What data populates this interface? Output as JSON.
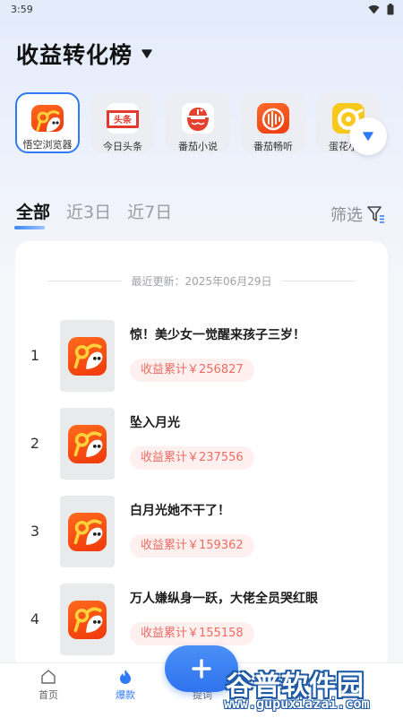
{
  "status_bar": {
    "time": "3:59"
  },
  "header": {
    "title": "收益转化榜"
  },
  "apps": [
    {
      "label": "悟空浏览器",
      "selected": true,
      "icon": "wukong-browser-icon"
    },
    {
      "label": "今日头条",
      "selected": false,
      "icon": "toutiao-icon"
    },
    {
      "label": "番茄小说",
      "selected": false,
      "icon": "fanqie-novel-icon"
    },
    {
      "label": "番茄畅听",
      "selected": false,
      "icon": "fanqie-listen-icon"
    },
    {
      "label": "蛋花小说",
      "selected": false,
      "icon": "danhua-novel-icon"
    }
  ],
  "tabs": [
    {
      "label": "全部",
      "active": true
    },
    {
      "label": "近3日",
      "active": false
    },
    {
      "label": "近7日",
      "active": false
    }
  ],
  "filter": {
    "label": "筛选"
  },
  "list": {
    "update_text": "最近更新：2025年06月29日",
    "items": [
      {
        "rank": "1",
        "title": "惊！美少女一觉醒来孩子三岁！",
        "earnings": "收益累计￥256827"
      },
      {
        "rank": "2",
        "title": "坠入月光",
        "earnings": "收益累计￥237556"
      },
      {
        "rank": "3",
        "title": "白月光她不干了！",
        "earnings": "收益累计￥159362"
      },
      {
        "rank": "4",
        "title": "万人嫌纵身一跃，大佬全员哭红眼",
        "earnings": "收益累计￥155158"
      }
    ]
  },
  "bottom_nav": [
    {
      "label": "首页",
      "icon": "home-icon",
      "active": false
    },
    {
      "label": "爆款",
      "icon": "flame-icon",
      "active": true
    },
    {
      "label": "提词",
      "icon": "prompt-icon",
      "active": false
    }
  ],
  "watermark": {
    "name": "谷普软件园",
    "url": "www.gupuxiazai.com"
  },
  "colors": {
    "accent": "#2f7bf5",
    "earnings_text": "#ee6c63",
    "earnings_bg": "#fdf0ef"
  }
}
